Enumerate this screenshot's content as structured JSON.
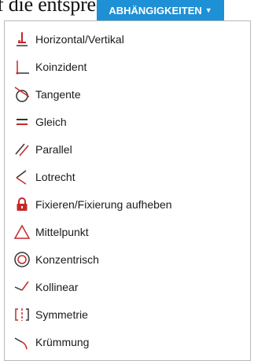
{
  "background_text": "f die entsprechenden",
  "header": {
    "label": "ABHÄNGIGKEITEN",
    "chevron_icon": "triangle-down",
    "color": "#1e90d6"
  },
  "menu": {
    "items": [
      {
        "label": "Horizontal/Vertikal",
        "icon": "horizontal-vertical-constraint-icon"
      },
      {
        "label": "Koinzident",
        "icon": "coincident-constraint-icon"
      },
      {
        "label": "Tangente",
        "icon": "tangent-constraint-icon"
      },
      {
        "label": "Gleich",
        "icon": "equal-constraint-icon"
      },
      {
        "label": "Parallel",
        "icon": "parallel-constraint-icon"
      },
      {
        "label": "Lotrecht",
        "icon": "perpendicular-constraint-icon"
      },
      {
        "label": "Fixieren/Fixierung aufheben",
        "icon": "lock-icon"
      },
      {
        "label": "Mittelpunkt",
        "icon": "midpoint-triangle-icon"
      },
      {
        "label": "Konzentrisch",
        "icon": "concentric-circles-icon"
      },
      {
        "label": "Kollinear",
        "icon": "collinear-constraint-icon"
      },
      {
        "label": "Symmetrie",
        "icon": "symmetry-constraint-icon"
      },
      {
        "label": "Krümmung",
        "icon": "curvature-constraint-icon"
      }
    ]
  }
}
